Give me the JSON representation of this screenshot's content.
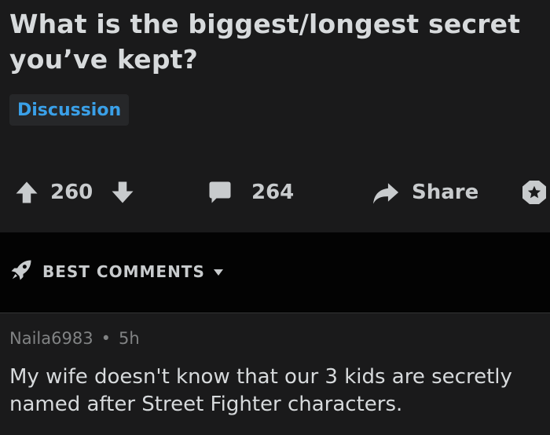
{
  "post": {
    "title": "What is the biggest/longest secret you’ve kept?",
    "flair": "Discussion"
  },
  "actions": {
    "score": "260",
    "comment_count": "264",
    "share_label": "Share",
    "icons": [
      "upvote-arrow-icon",
      "downvote-arrow-icon",
      "comment-bubble-icon",
      "share-arrow-icon",
      "save-star-icon"
    ]
  },
  "sort": {
    "label": "BEST COMMENTS",
    "icon": "rocket-icon"
  },
  "comment": {
    "author": "Naila6983",
    "separator": "•",
    "age": "5h",
    "body": "My wife doesn't know that our 3 kids are secretly named after Street Fighter characters."
  },
  "colors": {
    "background": "#1a1a1b",
    "sort_bar_background": "#030303",
    "text": "#d7dadc",
    "flair_text": "#3aa0e8",
    "muted": "#818384"
  }
}
